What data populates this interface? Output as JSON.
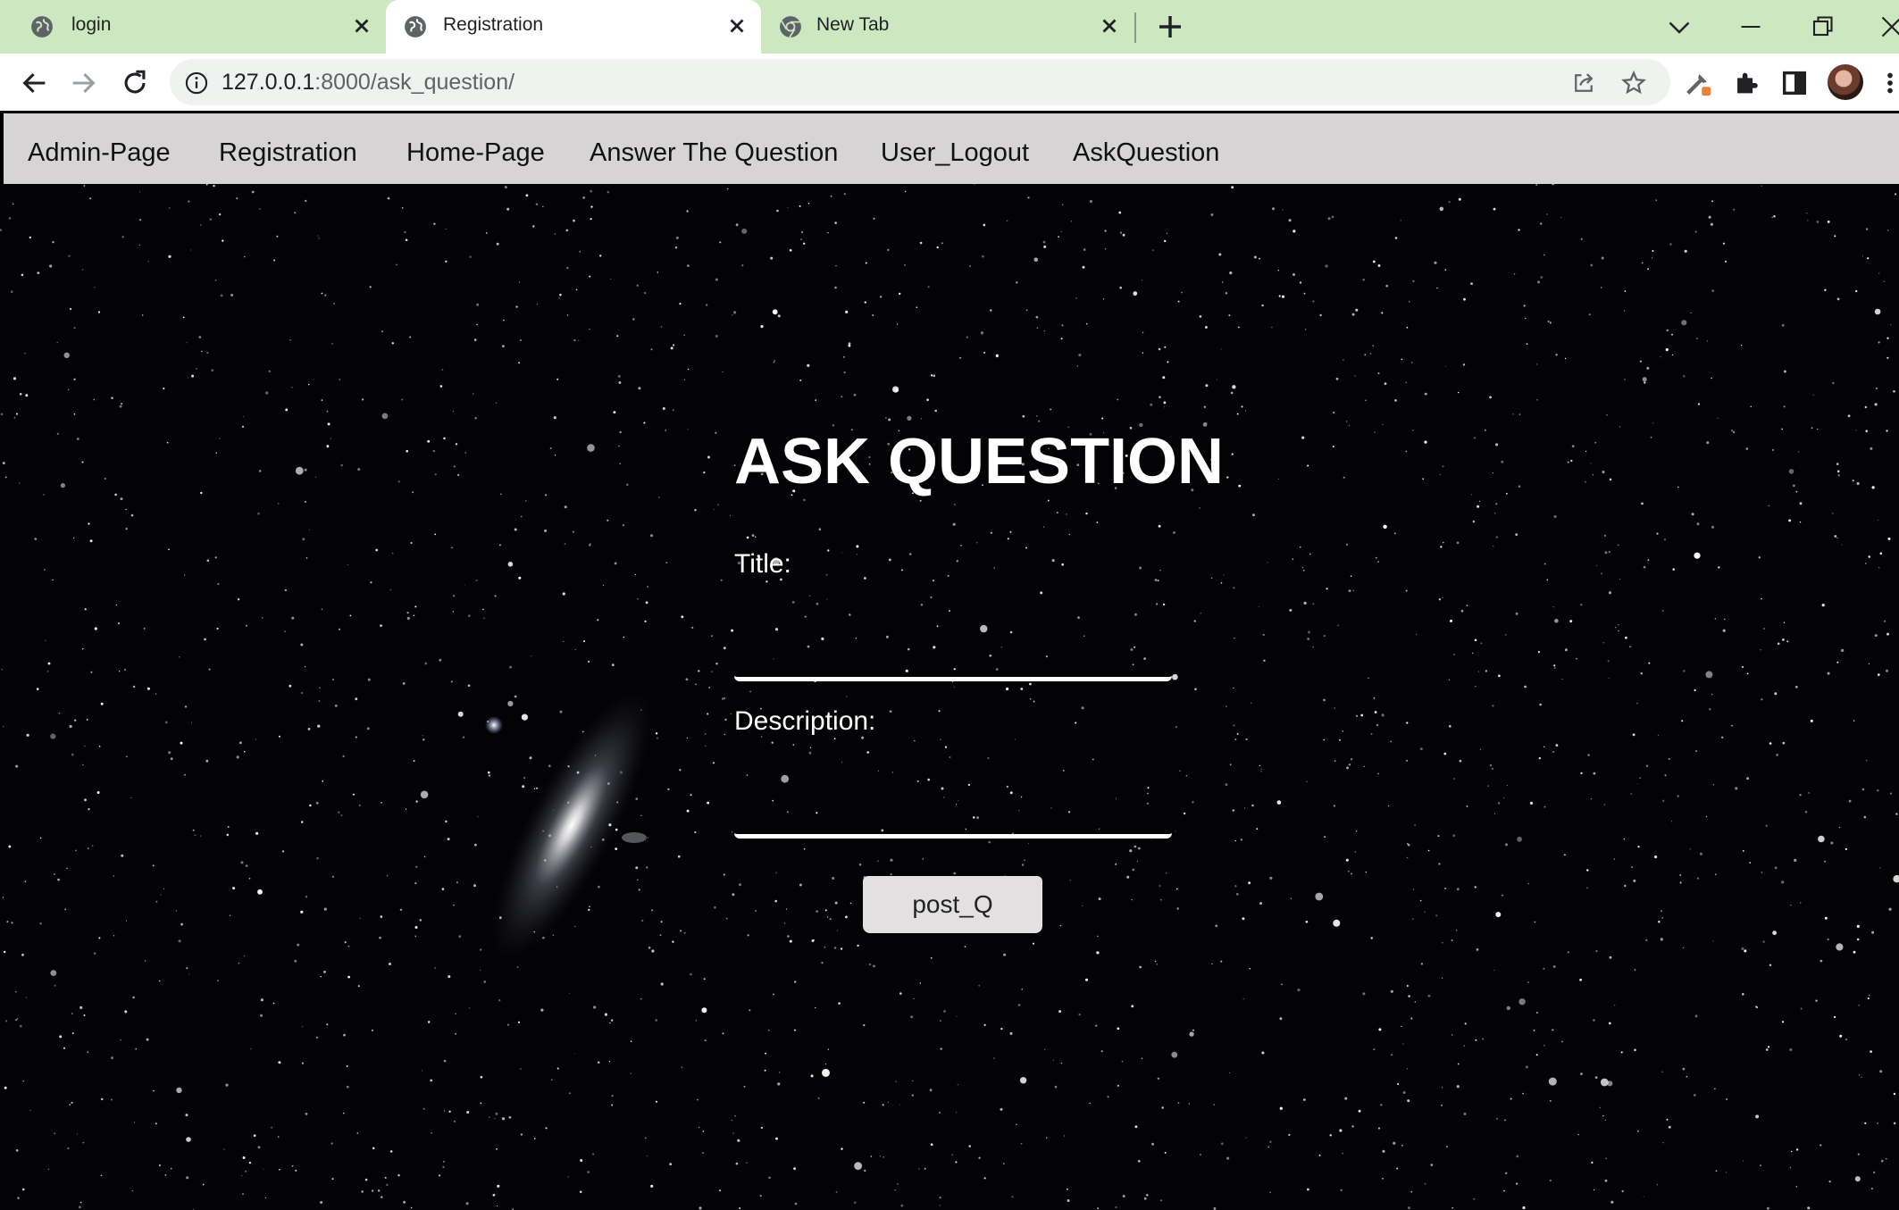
{
  "browser": {
    "tabs": [
      {
        "title": "login",
        "favicon": "globe-icon",
        "active": false
      },
      {
        "title": "Registration",
        "favicon": "globe-icon",
        "active": true
      },
      {
        "title": "New Tab",
        "favicon": "chrome-icon",
        "active": false
      }
    ],
    "url_host": "127.0.0.1",
    "url_rest": ":8000/ask_question/"
  },
  "nav": {
    "links": [
      "Admin-Page",
      "Registration",
      "Home-Page",
      "Answer The Question",
      "User_Logout",
      "AskQuestion"
    ]
  },
  "form": {
    "heading": "ASK QUESTION",
    "title_label": "Title:",
    "description_label": "Description:",
    "submit_label": "post_Q"
  },
  "colors": {
    "tabstrip": "#cde8c0",
    "navbar": "#d6d4d4",
    "page_background": "#030305",
    "button": "#e2e0e0"
  }
}
